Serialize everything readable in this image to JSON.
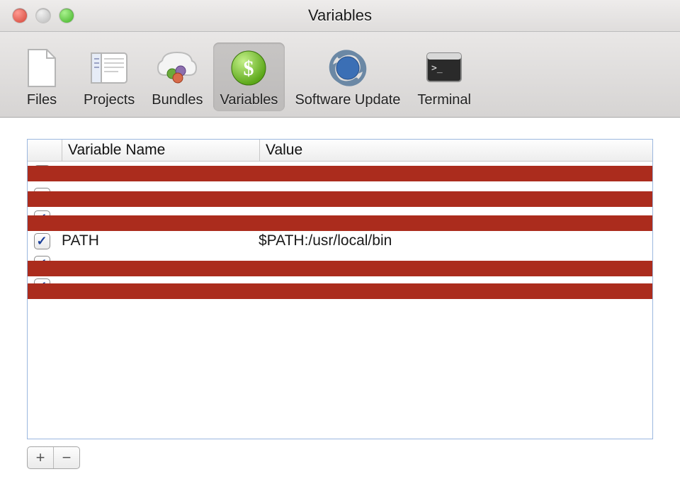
{
  "window": {
    "title": "Variables"
  },
  "toolbar": {
    "items": [
      {
        "id": "files",
        "label": "Files",
        "selected": false
      },
      {
        "id": "projects",
        "label": "Projects",
        "selected": false
      },
      {
        "id": "bundles",
        "label": "Bundles",
        "selected": false
      },
      {
        "id": "variables",
        "label": "Variables",
        "selected": true
      },
      {
        "id": "software-update",
        "label": "Software Update",
        "selected": false
      },
      {
        "id": "terminal",
        "label": "Terminal",
        "selected": false
      }
    ]
  },
  "table": {
    "columns": {
      "name": "Variable Name",
      "value": "Value"
    },
    "rows": [
      {
        "checked": true,
        "name": "",
        "value": "",
        "redacted": true
      },
      {
        "checked": true,
        "name": "",
        "value": "",
        "redacted": true
      },
      {
        "checked": true,
        "name": "",
        "value": "",
        "redacted": true
      },
      {
        "checked": true,
        "name": "PATH",
        "value": "$PATH:/usr/local/bin",
        "redacted": false
      },
      {
        "checked": true,
        "name": "",
        "value": "",
        "redacted": true
      },
      {
        "checked": true,
        "name": "",
        "value": "",
        "redacted": true
      }
    ]
  },
  "buttons": {
    "add": "+",
    "remove": "−"
  }
}
